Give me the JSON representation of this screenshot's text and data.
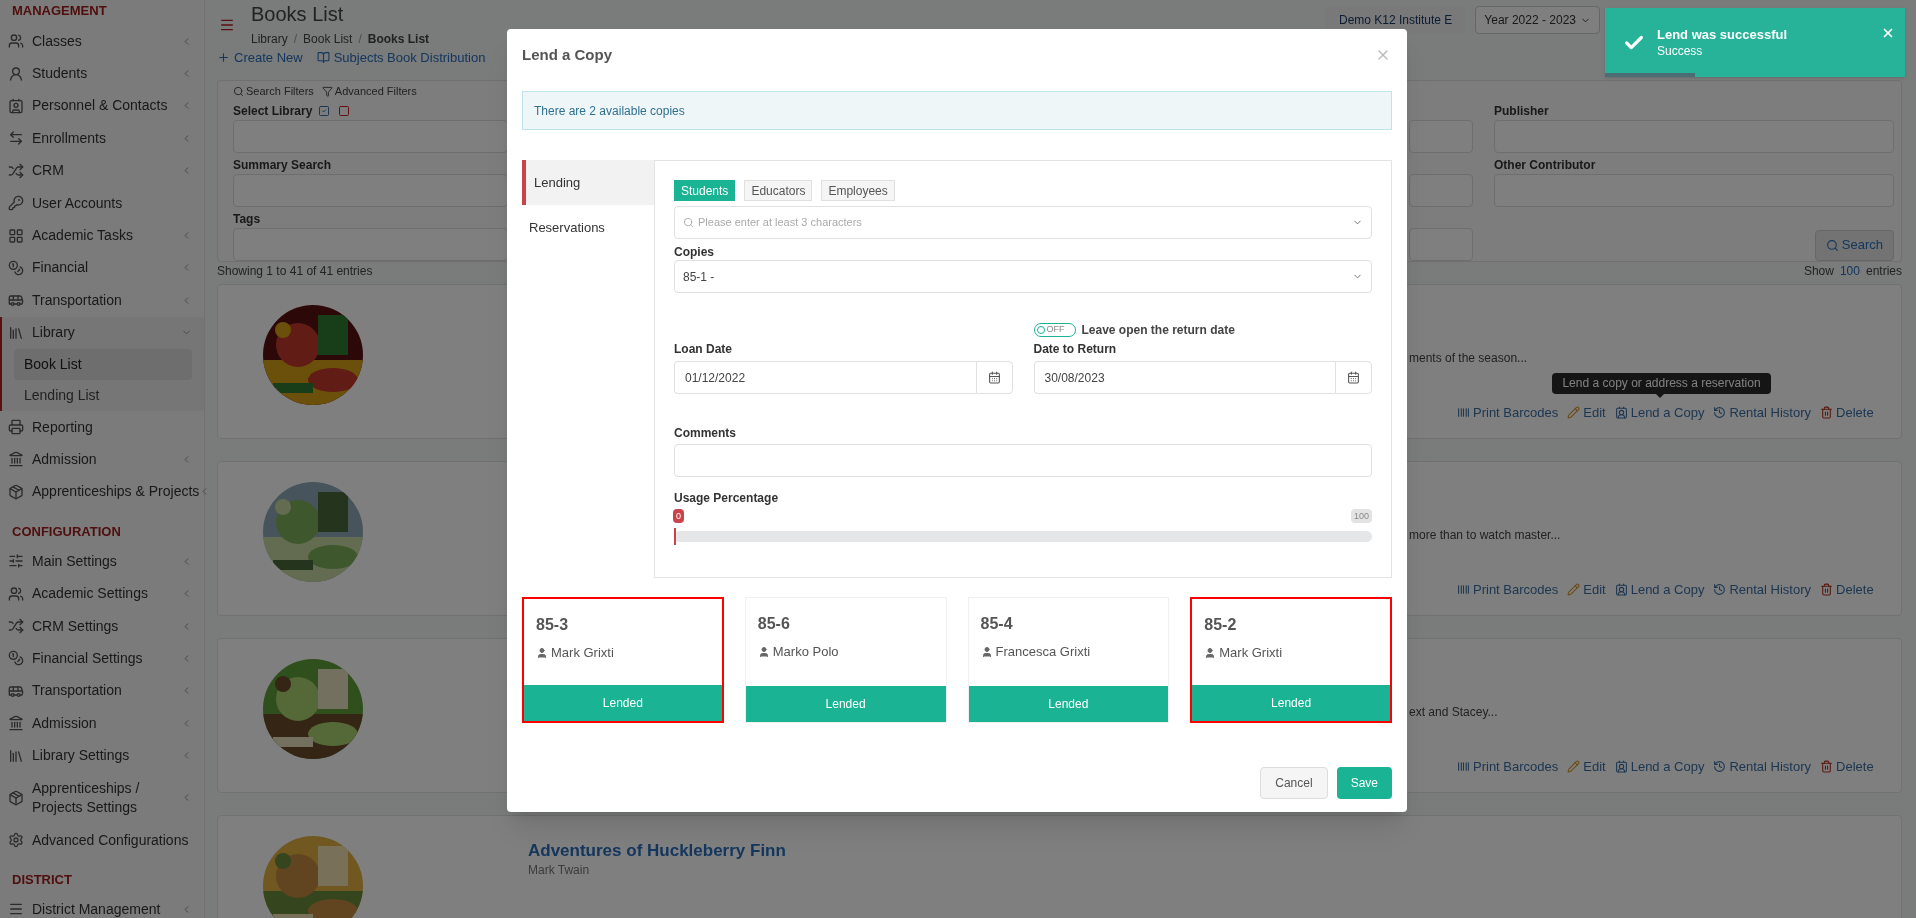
{
  "sidebar": {
    "sections": [
      {
        "heading": "MANAGEMENT",
        "items": [
          {
            "label": "Classes",
            "kind": "submenu",
            "expanded": false,
            "selected": false
          },
          {
            "label": "Students",
            "kind": "submenu",
            "expanded": false,
            "selected": false
          },
          {
            "label": "Personnel & Contacts",
            "kind": "submenu",
            "expanded": false,
            "selected": false
          },
          {
            "label": "Enrollments",
            "kind": "submenu",
            "expanded": false,
            "selected": false
          },
          {
            "label": "CRM",
            "kind": "submenu",
            "expanded": false,
            "selected": false
          },
          {
            "label": "User Accounts",
            "kind": "link",
            "selected": false
          },
          {
            "label": "Academic Tasks",
            "kind": "submenu",
            "expanded": false,
            "selected": false
          },
          {
            "label": "Financial",
            "kind": "submenu",
            "expanded": false,
            "selected": false
          },
          {
            "label": "Transportation",
            "kind": "submenu",
            "expanded": false,
            "selected": false
          },
          {
            "label": "Library",
            "kind": "submenu",
            "expanded": true,
            "selected": true,
            "children": [
              {
                "label": "Book List",
                "selected": true
              },
              {
                "label": "Lending List",
                "selected": false
              }
            ]
          },
          {
            "label": "Reporting",
            "kind": "link",
            "selected": false
          },
          {
            "label": "Admission",
            "kind": "submenu",
            "expanded": false,
            "selected": false
          },
          {
            "label": "Apprenticeships & Projects",
            "kind": "submenu",
            "expanded": false,
            "selected": false
          }
        ]
      },
      {
        "heading": "CONFIGURATION",
        "items": [
          {
            "label": "Main Settings",
            "kind": "submenu",
            "expanded": false,
            "selected": false
          },
          {
            "label": "Academic Settings",
            "kind": "submenu",
            "expanded": false,
            "selected": false
          },
          {
            "label": "CRM Settings",
            "kind": "submenu",
            "expanded": false,
            "selected": false
          },
          {
            "label": "Financial Settings",
            "kind": "submenu",
            "expanded": false,
            "selected": false
          },
          {
            "label": "Transportation",
            "kind": "submenu",
            "expanded": false,
            "selected": false
          },
          {
            "label": "Admission",
            "kind": "submenu",
            "expanded": false,
            "selected": false
          },
          {
            "label": "Library Settings",
            "kind": "submenu",
            "expanded": false,
            "selected": false
          },
          {
            "label": "Apprenticeships / Projects Settings",
            "kind": "submenu",
            "expanded": false,
            "selected": false
          },
          {
            "label": "Advanced Configurations",
            "kind": "link",
            "selected": false
          }
        ]
      },
      {
        "heading": "DISTRICT",
        "items": [
          {
            "label": "District Management",
            "kind": "submenu",
            "expanded": false,
            "selected": false
          }
        ]
      }
    ]
  },
  "header": {
    "title": "Books List",
    "breadcrumb": [
      "Library",
      "Book List",
      "Books List"
    ],
    "breadcrumb_separator": "/",
    "institute": "Demo K12 Institute E",
    "year": "Year 2022 - 2023"
  },
  "toolbar": [
    "Create New",
    "Subjects Book Distribution"
  ],
  "filters": {
    "modes": [
      "Search Filters",
      "Advanced Filters"
    ],
    "library_label": "Select Library",
    "left_fields": [
      "Summary Search",
      "Tags"
    ],
    "right_fields": [
      "Publisher",
      "Other Contributor"
    ],
    "search_button": "Search"
  },
  "results": {
    "summary": "Showing 1 to 41 of 41 entries",
    "show_prefix": "Show",
    "page_size": "100",
    "show_suffix": "entries"
  },
  "books": [
    {
      "description": "ments of the season...",
      "tooltip": "Lend a copy or address a reservation",
      "actions": [
        "Print Barcodes",
        "Edit",
        "Lend a Copy",
        "Rental History",
        "Delete"
      ]
    },
    {
      "description": "more than to watch master...",
      "actions": [
        "Print Barcodes",
        "Edit",
        "Lend a Copy",
        "Rental History",
        "Delete"
      ]
    },
    {
      "description": "ext and Stacey...",
      "actions": [
        "Print Barcodes",
        "Edit",
        "Lend a Copy",
        "Rental History",
        "Delete"
      ]
    },
    {
      "title": "Adventures of Huckleberry Finn",
      "author": "Mark Twain"
    }
  ],
  "modal": {
    "title": "Lend a Copy",
    "alert": "There are 2 available copies",
    "tabs": [
      {
        "label": "Lending",
        "selected": true
      },
      {
        "label": "Reservations",
        "selected": false
      }
    ],
    "audience": [
      {
        "label": "Students",
        "selected": true
      },
      {
        "label": "Educators",
        "selected": false
      },
      {
        "label": "Employees",
        "selected": false
      }
    ],
    "person_search": {
      "placeholder": "Please enter at least 3 characters"
    },
    "copies": {
      "label": "Copies",
      "value": "85-1 -"
    },
    "open_return": {
      "on": false,
      "state_label": "OFF",
      "label": "Leave open the return date"
    },
    "loan_date": {
      "label": "Loan Date",
      "value": "01/12/2022"
    },
    "return_date": {
      "label": "Date to Return",
      "value": "30/08/2023"
    },
    "comments": {
      "label": "Comments"
    },
    "usage": {
      "label": "Usage Percentage",
      "level": 0,
      "reading": "0",
      "max": "100"
    },
    "copy_cards": [
      {
        "code": "85-3",
        "borrower": "Mark Grixti",
        "status": "Lended",
        "highlighted": true
      },
      {
        "code": "85-6",
        "borrower": "Marko Polo",
        "status": "Lended",
        "highlighted": false
      },
      {
        "code": "85-4",
        "borrower": "Francesca Grixti",
        "status": "Lended",
        "highlighted": false
      },
      {
        "code": "85-2",
        "borrower": "Mark Grixti",
        "status": "Lended",
        "highlighted": true
      }
    ],
    "buttons": [
      "Cancel",
      "Save"
    ]
  },
  "toast": {
    "title": "Lend was successful",
    "message": "Success",
    "level": 0.3
  }
}
